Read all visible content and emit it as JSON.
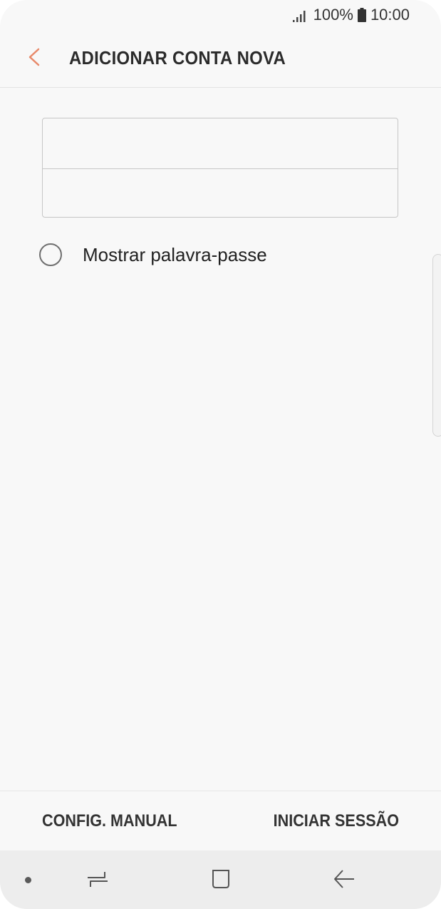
{
  "status_bar": {
    "battery": "100%",
    "time": "10:00",
    "icons": [
      "signal-icon",
      "battery-icon"
    ]
  },
  "header": {
    "title": "ADICIONAR CONTA NOVA",
    "back_icon": "chevron-left-icon"
  },
  "form": {
    "email_value": "",
    "password_value": "",
    "show_password_label": "Mostrar palavra-passe",
    "show_password_checked": false
  },
  "actions": {
    "manual_label": "CONFIG. MANUAL",
    "sign_in_label": "INICIAR SESSÃO"
  },
  "nav_bar": {
    "icons": [
      "recents-icon",
      "home-icon",
      "back-arrow-icon"
    ]
  },
  "colors": {
    "accent": "#e8896a",
    "background": "#f8f8f8",
    "nav_background": "#ededed"
  }
}
